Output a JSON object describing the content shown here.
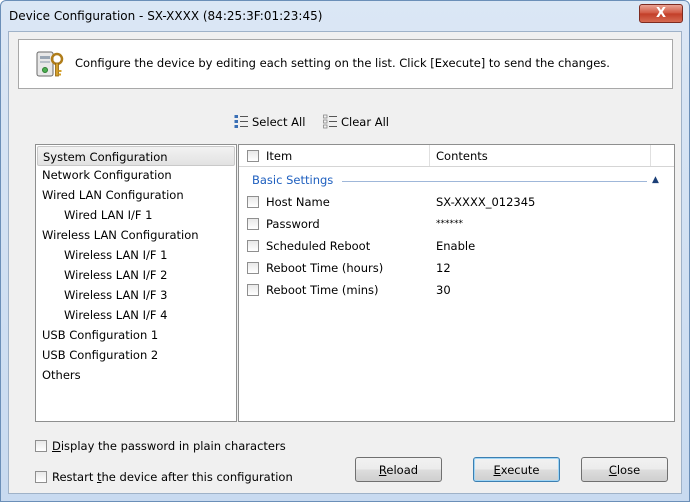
{
  "window": {
    "title": "Device Configuration - SX-XXXX (84:25:3F:01:23:45)",
    "close_glyph": "X"
  },
  "banner": {
    "text": "Configure the device by editing each setting on the list. Click [Execute] to send the changes.",
    "icon": "device-settings-icon"
  },
  "selection": {
    "select_all": "Select All",
    "clear_all": "Clear All"
  },
  "tree": {
    "items": [
      {
        "label": "System Configuration",
        "indent": 0,
        "selected": true
      },
      {
        "label": "Network Configuration",
        "indent": 0
      },
      {
        "label": "Wired LAN Configuration",
        "indent": 0
      },
      {
        "label": "Wired LAN I/F 1",
        "indent": 1
      },
      {
        "label": "Wireless LAN Configuration",
        "indent": 0
      },
      {
        "label": "Wireless LAN I/F 1",
        "indent": 1
      },
      {
        "label": "Wireless LAN I/F 2",
        "indent": 1
      },
      {
        "label": "Wireless LAN I/F 3",
        "indent": 1
      },
      {
        "label": "Wireless LAN I/F 4",
        "indent": 1
      },
      {
        "label": "USB Configuration 1",
        "indent": 0
      },
      {
        "label": "USB Configuration 2",
        "indent": 0
      },
      {
        "label": "Others",
        "indent": 0
      }
    ]
  },
  "table": {
    "headers": {
      "item": "Item",
      "contents": "Contents"
    },
    "group": {
      "label": "Basic Settings",
      "collapse_glyph": "▲"
    },
    "rows": [
      {
        "item": "Host Name",
        "contents": "SX-XXXX_012345"
      },
      {
        "item": "Password",
        "contents": "******"
      },
      {
        "item": "Scheduled Reboot",
        "contents": "Enable"
      },
      {
        "item": "Reboot Time (hours)",
        "contents": "12"
      },
      {
        "item": "Reboot Time (mins)",
        "contents": "30"
      }
    ]
  },
  "options": {
    "show_password": {
      "u": "D",
      "rest": "isplay the password in plain characters"
    },
    "restart": {
      "pre": "Restart ",
      "u": "t",
      "rest": "he device after this configuration"
    }
  },
  "buttons": {
    "reload": {
      "u": "R",
      "rest": "eload"
    },
    "execute": {
      "u": "E",
      "rest": "xecute"
    },
    "close": {
      "u": "C",
      "rest": "lose"
    }
  },
  "colors": {
    "group_label": "#1e5fbf",
    "title_close": "#c23d27"
  }
}
